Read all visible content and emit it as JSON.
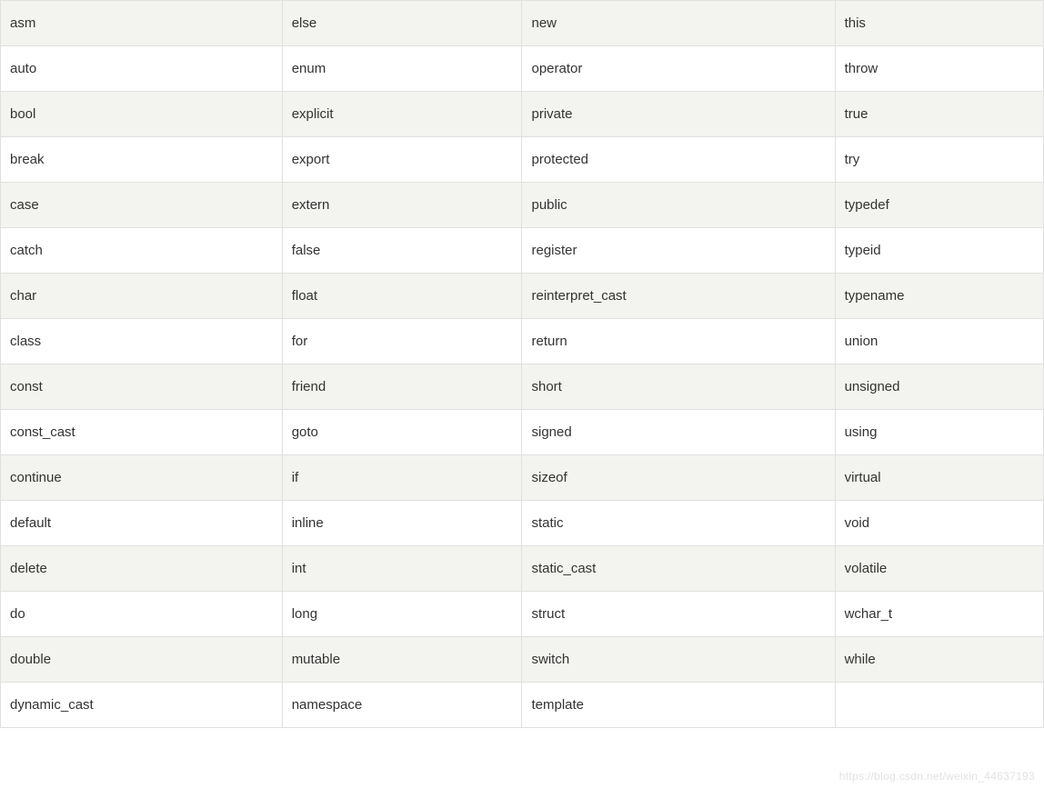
{
  "table": {
    "rows": [
      [
        "asm",
        "else",
        "new",
        "this"
      ],
      [
        "auto",
        "enum",
        "operator",
        "throw"
      ],
      [
        "bool",
        "explicit",
        "private",
        "true"
      ],
      [
        "break",
        "export",
        "protected",
        "try"
      ],
      [
        "case",
        "extern",
        "public",
        "typedef"
      ],
      [
        "catch",
        "false",
        "register",
        "typeid"
      ],
      [
        "char",
        "float",
        "reinterpret_cast",
        "typename"
      ],
      [
        "class",
        "for",
        "return",
        "union"
      ],
      [
        "const",
        "friend",
        "short",
        "unsigned"
      ],
      [
        "const_cast",
        "goto",
        "signed",
        "using"
      ],
      [
        "continue",
        "if",
        "sizeof",
        "virtual"
      ],
      [
        "default",
        "inline",
        "static",
        "void"
      ],
      [
        "delete",
        "int",
        "static_cast",
        "volatile"
      ],
      [
        "do",
        "long",
        "struct",
        "wchar_t"
      ],
      [
        "double",
        "mutable",
        "switch",
        "while"
      ],
      [
        "dynamic_cast",
        "namespace",
        "template",
        ""
      ]
    ]
  },
  "watermark": "https://blog.csdn.net/weixin_44637193"
}
